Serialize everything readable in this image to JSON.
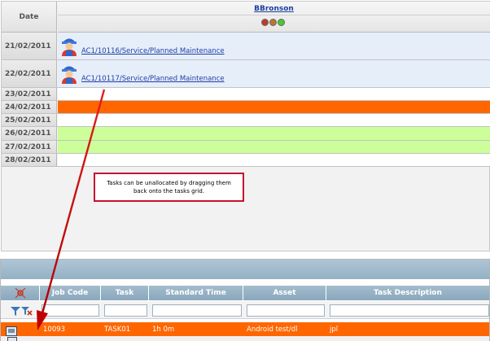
{
  "calendar": {
    "date_header": "Date",
    "resource": {
      "name": "BBronson",
      "status_lights": [
        {
          "name": "red-light",
          "color": "#c0392b"
        },
        {
          "name": "amber-light",
          "color": "#b9772f"
        },
        {
          "name": "green-light",
          "color": "#3fcf28"
        }
      ]
    },
    "rows": [
      {
        "date": "21/02/2011",
        "fill": "#e6eefa",
        "task": "AC1/10116/Service/Planned Maintenance"
      },
      {
        "date": "22/02/2011",
        "fill": "#e6eefa",
        "task": "AC1/10117/Service/Planned Maintenance"
      },
      {
        "date": "23/02/2011",
        "fill": "#ffffff",
        "task": ""
      },
      {
        "date": "24/02/2011",
        "fill": "#ff6600",
        "task": ""
      },
      {
        "date": "25/02/2011",
        "fill": "#ffffff",
        "task": ""
      },
      {
        "date": "26/02/2011",
        "fill": "#ccff99",
        "task": ""
      },
      {
        "date": "27/02/2011",
        "fill": "#ccff99",
        "task": ""
      },
      {
        "date": "28/02/2011",
        "fill": "#ffffff",
        "task": ""
      }
    ]
  },
  "callout": {
    "line1": "Tasks can be unallocated by dragging them",
    "line2": "back onto the tasks grid."
  },
  "grid": {
    "columns": [
      "",
      "Job Code",
      "Task",
      "Standard Time",
      "Asset",
      "Task Description"
    ],
    "rows": [
      {
        "job_code": "10093",
        "task": "TASK01",
        "standard_time": "1h 0m",
        "asset": "Android test/dl",
        "description": "jpl"
      }
    ]
  },
  "colors": {
    "accent_orange": "#ff6600",
    "grid_header": "#9ab4c8",
    "arrow": "#d01010"
  }
}
